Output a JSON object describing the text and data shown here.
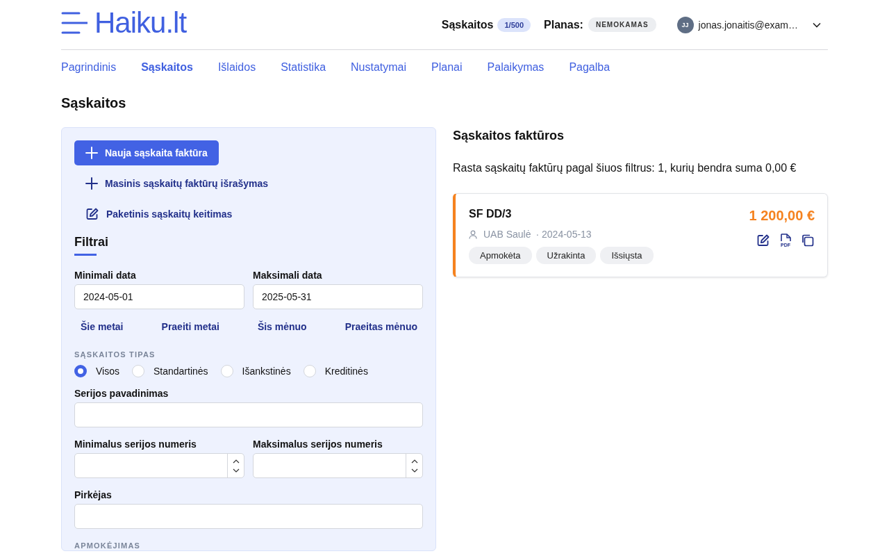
{
  "header": {
    "logo": "Haiku.lt",
    "invoices_label": "Sąskaitos",
    "invoices_count": "1/500",
    "plan_label": "Planas:",
    "plan": "NEMOKAMAS",
    "user_initials": "JJ",
    "user_email": "jonas.jonaitis@exam…"
  },
  "nav": [
    {
      "label": "Pagrindinis",
      "selected": false
    },
    {
      "label": "Sąskaitos",
      "selected": true
    },
    {
      "label": "Išlaidos",
      "selected": false
    },
    {
      "label": "Statistika",
      "selected": false
    },
    {
      "label": "Nustatymai",
      "selected": false
    },
    {
      "label": "Planai",
      "selected": false
    },
    {
      "label": "Palaikymas",
      "selected": false
    },
    {
      "label": "Pagalba",
      "selected": false
    }
  ],
  "page_title": "Sąskaitos",
  "sidebar": {
    "actions": [
      {
        "kind": "primary",
        "label": "Nauja sąskaita faktūra"
      },
      {
        "kind": "add",
        "label": "Masinis sąskaitų faktūrų išrašymas"
      },
      {
        "kind": "edit",
        "label": "Paketinis sąskaitų keitimas"
      }
    ],
    "filters_title": "Filtrai",
    "date_fields": [
      {
        "label": "Minimali data",
        "value": "2024-05-01"
      },
      {
        "label": "Maksimali data",
        "value": "2025-05-31"
      }
    ],
    "quick_ranges": [
      "Šie metai",
      "Praeiti metai",
      "Šis mėnuo",
      "Praeitas mėnuo"
    ],
    "type_label": "SĄSKAITOS TIPAS",
    "types": [
      {
        "label": "Visos",
        "selected": true
      },
      {
        "label": "Standartinės",
        "selected": false
      },
      {
        "label": "Išankstinės",
        "selected": false
      },
      {
        "label": "Kreditinės",
        "selected": false
      }
    ],
    "series_name": {
      "label": "Serijos pavadinimas"
    },
    "number_fields": [
      {
        "label": "Minimalus serijos numeris"
      },
      {
        "label": "Maksimalus serijos numeris"
      }
    ],
    "buyer": {
      "label": "Pirkėjas"
    },
    "next_section": "APMOKĖJIMAS"
  },
  "list": {
    "title": "Sąskaitos faktūros",
    "summary": "Rasta sąskaitų faktūrų pagal šiuos filtrus: 1, kurių bendra suma 0,00 €",
    "invoices": [
      {
        "number": "SF DD/3",
        "buyer": "UAB Saulė",
        "date": "· 2024-05-13",
        "amount": "1 200,00 €",
        "pdf_label": "PDF",
        "tags": [
          "Apmokėta",
          "Užrakinta",
          "Išsiųsta"
        ]
      }
    ]
  }
}
